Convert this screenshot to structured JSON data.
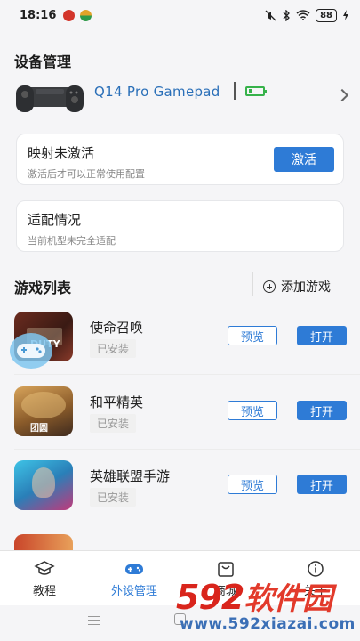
{
  "status_bar": {
    "time": "18:16",
    "battery": "88"
  },
  "device_section": {
    "title": "设备管理",
    "device_name": "Q14 Pro Gamepad"
  },
  "mapping_card": {
    "title": "映射未激活",
    "subtitle": "激活后才可以正常使用配置",
    "button": "激活"
  },
  "adapt_card": {
    "title": "适配情况",
    "subtitle": "当前机型未完全适配"
  },
  "game_list": {
    "title": "游戏列表",
    "add_label": "添加游戏",
    "preview_label": "预览",
    "open_label": "打开",
    "games": [
      {
        "name": "使命召唤",
        "status": "已安装",
        "icon_text": "DUTY"
      },
      {
        "name": "和平精英",
        "status": "已安装",
        "icon_text": "团圆"
      },
      {
        "name": "英雄联盟手游",
        "status": "已安装",
        "icon_text": ""
      }
    ]
  },
  "tabbar": {
    "tabs": [
      {
        "label": "教程",
        "icon": "graduation-cap-icon"
      },
      {
        "label": "外设管理",
        "icon": "gamepad-icon",
        "active": true
      },
      {
        "label": "商城",
        "icon": "shop-icon"
      },
      {
        "label": "关于",
        "icon": "info-icon"
      }
    ]
  },
  "watermark": {
    "logo_num": "592",
    "logo_text": "软件园",
    "url": "www.592xiazai.com"
  },
  "colors": {
    "accent": "#2e7bd6",
    "battery_green": "#36b24a"
  }
}
